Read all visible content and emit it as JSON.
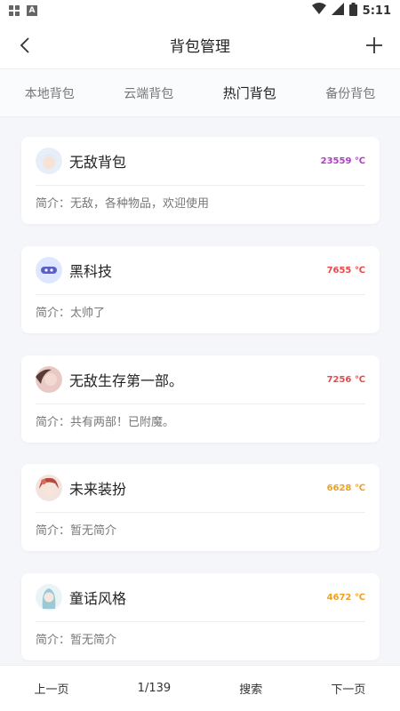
{
  "status_bar": {
    "time": "5:11"
  },
  "header": {
    "title": "背包管理"
  },
  "tabs": [
    {
      "label": "本地背包",
      "active": false
    },
    {
      "label": "云端背包",
      "active": false
    },
    {
      "label": "热门背包",
      "active": true
    },
    {
      "label": "备份背包",
      "active": false
    }
  ],
  "cards": [
    {
      "title": "无敌背包",
      "temp": "23559 ℃",
      "temp_color": "#b23cc9",
      "desc": "简介：无敌，各种物品，欢迎使用",
      "avatar": "girl-avatar"
    },
    {
      "title": "黑科技",
      "temp": "7655 ℃",
      "temp_color": "#e84a4a",
      "desc": "简介：太帅了",
      "avatar": "robot-avatar"
    },
    {
      "title": "无敌生存第一部。",
      "temp": "7256 ℃",
      "temp_color": "#e84a4a",
      "desc": "简介：共有两部！已附魔。",
      "avatar": "photo-avatar"
    },
    {
      "title": "未来装扮",
      "temp": "6628 ℃",
      "temp_color": "#f0a020",
      "desc": "简介：暂无简介",
      "avatar": "anime-avatar"
    },
    {
      "title": "童话风格",
      "temp": "4672 ℃",
      "temp_color": "#f0a020",
      "desc": "简介：暂无简介",
      "avatar": "fairy-avatar"
    }
  ],
  "pagination": {
    "prev_label": "上一页",
    "page_indicator": "1/139",
    "search_label": "搜索",
    "next_label": "下一页"
  }
}
